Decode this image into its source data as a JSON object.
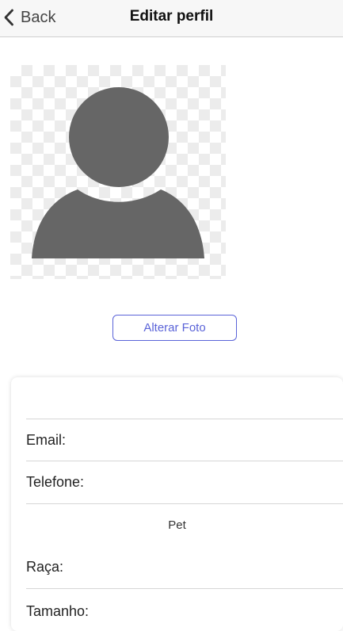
{
  "nav": {
    "back_label": "Back",
    "title": "Editar perfil"
  },
  "profile": {
    "avatar_icon": "user-placeholder-icon",
    "change_photo_label": "Alterar Foto"
  },
  "form": {
    "name_value": "",
    "email_label": "Email:",
    "email_value": "",
    "phone_label": "Telefone:",
    "phone_value": "",
    "pet_section_label": "Pet",
    "breed_label": "Raça:",
    "breed_value": "",
    "size_label": "Tamanho:"
  },
  "colors": {
    "accent": "#5a63d8",
    "avatar_gray": "#666666",
    "nav_background": "#f7f7f7"
  }
}
